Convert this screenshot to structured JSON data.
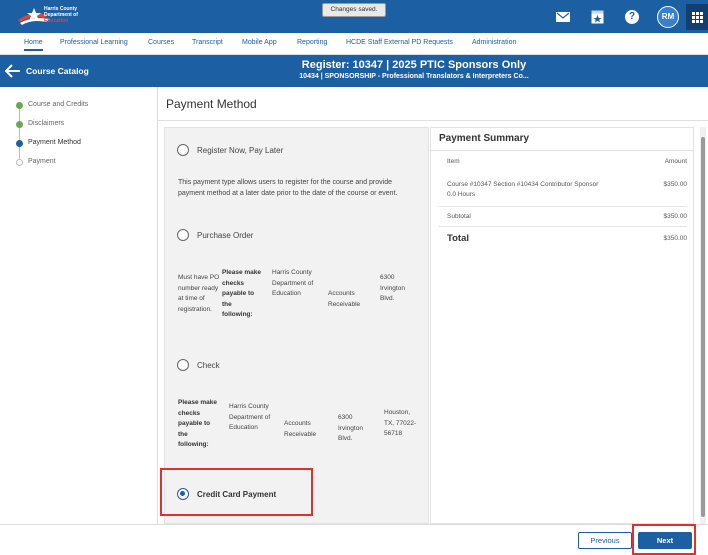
{
  "brand": {
    "line1": "Harris County",
    "line2": "Department of",
    "line3": "Education"
  },
  "toast": "Changes saved.",
  "topbar": {
    "avatar_initials": "RM",
    "icons": [
      "mail-icon",
      "award-icon",
      "help-icon",
      "apps-grid-icon"
    ]
  },
  "nav": {
    "items": [
      "Home",
      "Professional Learning",
      "Courses",
      "Transcript",
      "Mobile App",
      "Reporting",
      "HCDE Staff External PD Requests",
      "Administration"
    ],
    "active": "Home"
  },
  "header": {
    "back_label": "Course Catalog",
    "title": "Register: 10347 | 2025 PTIC Sponsors Only",
    "subtitle": "10434 | SPONSORSHIP - Professional Translators & Interpreters Co..."
  },
  "steps": [
    {
      "label": "Course and Credits",
      "state": "done"
    },
    {
      "label": "Disclaimers",
      "state": "done"
    },
    {
      "label": "Payment Method",
      "state": "current"
    },
    {
      "label": "Payment",
      "state": "pending"
    }
  ],
  "page_title": "Payment Method",
  "options": {
    "register_now": {
      "label": "Register Now, Pay Later",
      "description": "This payment type allows users to register for the course and provide payment method at a later date prior to the date of the course or event."
    },
    "purchase_order": {
      "label": "Purchase Order",
      "cells": [
        "Must have PO number ready at time of registration.",
        "Please make checks payable to the following:",
        "Harris County Department of Education",
        "Accounts Receivable",
        "6300 Irvington Blvd."
      ]
    },
    "check": {
      "label": "Check",
      "cells": [
        "Please make checks payable to the following:",
        "Harris County Department of Education",
        "Accounts Receivable",
        "6300 Irvington Blvd.",
        "Houston, TX, 77022-56718"
      ]
    },
    "credit_card": {
      "label": "Credit Card Payment",
      "selected": true
    }
  },
  "summary": {
    "title": "Payment Summary",
    "col_item": "Item",
    "col_amount": "Amount",
    "line_item": "Course #10347 Section #10434 Contributor Sponsor",
    "line_hours": "0.0 Hours",
    "line_amount": "$350.00",
    "subtotal_label": "Subtotal",
    "subtotal": "$350.00",
    "total_label": "Total",
    "total": "$350.00"
  },
  "footer": {
    "previous": "Previous",
    "next": "Next"
  },
  "colors": {
    "primary": "#1d5fa3",
    "highlight": "#e03030",
    "done": "#6aa84f"
  }
}
